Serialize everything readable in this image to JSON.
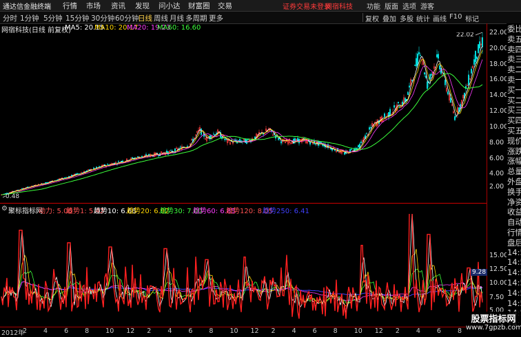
{
  "titlebar": {
    "app_name": "通达信金融终端",
    "menus": [
      "行情",
      "市场",
      "资讯",
      "发现",
      "问小达",
      "财富圈",
      "交易"
    ],
    "alert_login": "证券交易未登录",
    "alert_stock": "网宿科技",
    "right_menus": [
      "功能",
      "版面",
      "选项",
      "游客"
    ]
  },
  "toolbar": {
    "periods": [
      "分时",
      "1分钟",
      "5分钟",
      "15分钟",
      "30分钟",
      "60分钟",
      "日线",
      "周线",
      "月线",
      "多周期",
      "更多"
    ],
    "active_period": "日线",
    "right_tools": [
      "复权",
      "叠加",
      "多股",
      "统计",
      "画线",
      "F10",
      "标记"
    ]
  },
  "infobar": {
    "stock_title": "网宿科技(日线 前复权)",
    "ma": [
      {
        "label": "MA5: 20.15",
        "color": "#ffffff"
      },
      {
        "label": "MA10: 20.17",
        "color": "#ffd700"
      },
      {
        "label": "MA20: 19.23",
        "color": "#ff3cff"
      },
      {
        "label": "MA60: 16.60",
        "color": "#3cff3c"
      }
    ]
  },
  "indicator_bar": {
    "name": "聚标指标网",
    "items": [
      {
        "label": "动力: 5.06",
        "color": "#ff5252"
      },
      {
        "label": "趋势1: 5.42",
        "color": "#ff5252"
      },
      {
        "label": "趋势10: 6.66",
        "color": "#ffffff"
      },
      {
        "label": "趋势20: 6.92",
        "color": "#ffd700"
      },
      {
        "label": "趋势30: 7.00",
        "color": "#3cff3c"
      },
      {
        "label": "趋势60: 6.85",
        "color": "#ff3cff"
      },
      {
        "label": "趋势120: 8.05",
        "color": "#ff5252"
      },
      {
        "label": "趋势250: 6.41",
        "color": "#4040ff"
      }
    ]
  },
  "price_axis": [
    "22.00",
    "20.00",
    "18.00",
    "16.00",
    "14.00",
    "12.00",
    "10.00",
    "8.00",
    "6.00",
    "4.00",
    "2.00"
  ],
  "indicator_axis": [
    "15.00",
    "12.50",
    "10.00",
    "7.50",
    "5.00"
  ],
  "indicator_marker": "9.28",
  "price_annotations": {
    "high": "22.02",
    "low": "0.48"
  },
  "time_axis": [
    "2012年",
    "2",
    "4",
    "6",
    "8",
    "10",
    "12",
    "2",
    "4",
    "6",
    "8",
    "10",
    "12",
    "2",
    "4",
    "6",
    "8",
    "10",
    "12",
    "2",
    "4",
    "6",
    "8"
  ],
  "right_panel": [
    "委比",
    "卖五",
    "卖四",
    "卖三",
    "卖二",
    "卖一",
    "买一",
    "买二",
    "买三",
    "买四",
    "买五",
    "现价",
    "涨跌",
    "涨幅",
    "总量",
    "外盘",
    "换手",
    "净资",
    "收益",
    "自动",
    "行情",
    "盘后",
    "14:5",
    "14:5",
    "14:5",
    "14:5",
    "14:5",
    "14:5",
    "14:5",
    "14:5"
  ],
  "watermark": {
    "line1": "股票指标网",
    "line2": "www.7gpzb.com"
  },
  "colors": {
    "up": "#ff3c3c",
    "down": "#00e0e0",
    "frame": "#aa0000"
  }
}
